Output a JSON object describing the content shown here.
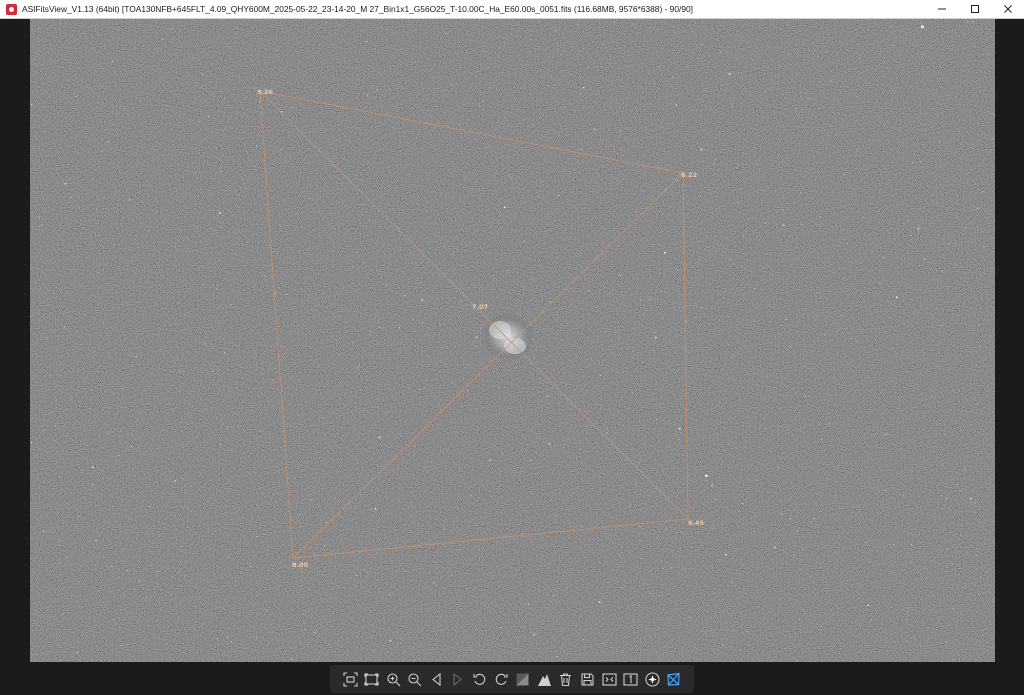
{
  "window": {
    "title": "ASIFitsView_V1.13 (64bit) [TOA130NFB+645FLT_4.09_QHY600M_2025-05-22_23-14-20_M 27_Bin1x1_G56O25_T-10.00C_Ha_E60.00s_0051.fits (116.68MB, 9576*6388) - 90/90]",
    "app_icon": "asifitsview-app-icon",
    "controls": [
      "minimize-icon",
      "maximize-icon",
      "close-icon"
    ]
  },
  "image": {
    "object": "M 27",
    "fwhm_labels": {
      "top_left": "9.26",
      "top_right": "6.22",
      "center": "7.07",
      "bottom_right": "6.45",
      "bottom_left": "8.00"
    },
    "overlay_color": "#c8926a"
  },
  "toolbar": {
    "buttons": [
      "fit-to-window-icon",
      "actual-size-icon",
      "zoom-in-icon",
      "zoom-out-icon",
      "previous-image-icon",
      "next-image-icon",
      "rotate-left-icon",
      "rotate-right-icon",
      "stretch-toggle-icon",
      "histogram-icon",
      "delete-icon",
      "save-icon",
      "compare-icon",
      "one-to-one-icon",
      "star-detection-icon",
      "tilt-analysis-icon"
    ]
  }
}
